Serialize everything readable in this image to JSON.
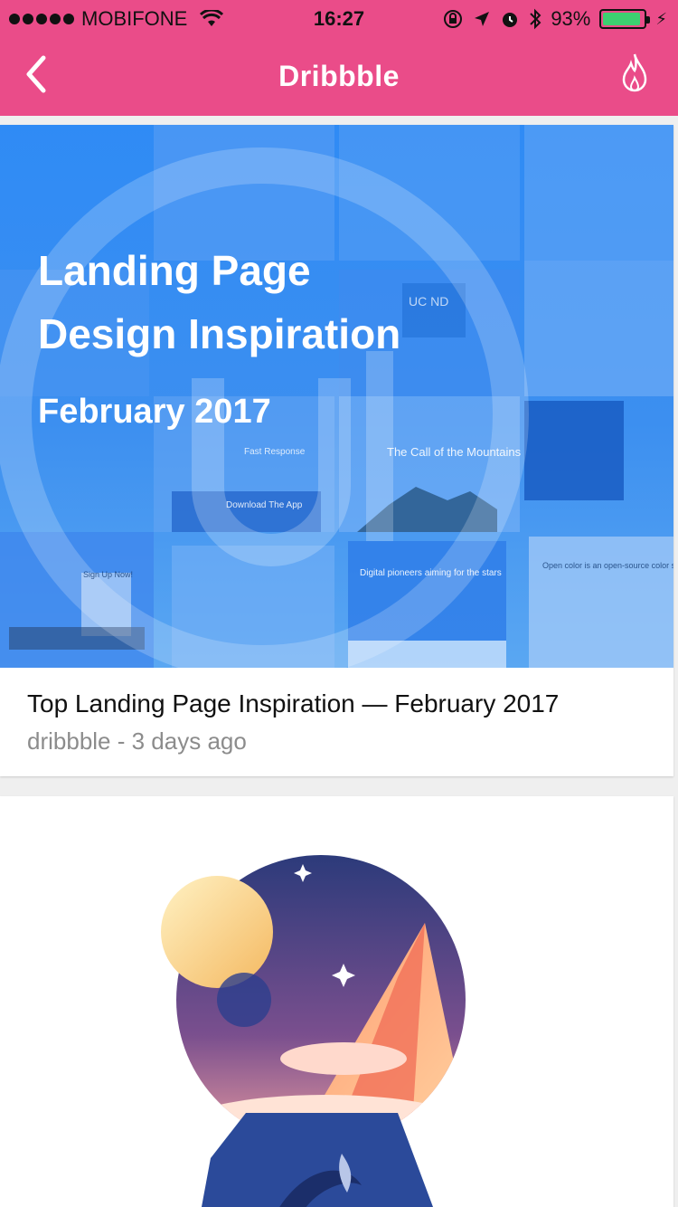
{
  "status_bar": {
    "carrier": "MOBIFONE",
    "time": "16:27",
    "battery_percent": "93%",
    "battery_level": 0.93,
    "icons": [
      "signal-dots-icon",
      "wifi-icon",
      "rotation-lock-icon",
      "location-icon",
      "alarm-icon",
      "bluetooth-icon",
      "battery-icon",
      "charging-icon"
    ]
  },
  "nav": {
    "title": "Dribbble",
    "back_icon": "chevron-left-icon",
    "action_icon": "flame-icon",
    "color": "#ea4c89"
  },
  "feed": [
    {
      "image": {
        "headline_line1": "Landing Page",
        "headline_line2": "Design Inspiration",
        "subheadline": "February 2017",
        "tile_texts": [
          "UC ND",
          "The Call of the Mountains",
          "Fast Response",
          "Download The App",
          "Digital pioneers aiming for the stars",
          "Open color is an open-source color scheme",
          "Sign Up Now!"
        ]
      },
      "title": "Top Landing Page Inspiration — February 2017",
      "meta": "dribbble - 3 days ago"
    },
    {
      "image_desc_icon": "space-illustration-icon"
    }
  ]
}
